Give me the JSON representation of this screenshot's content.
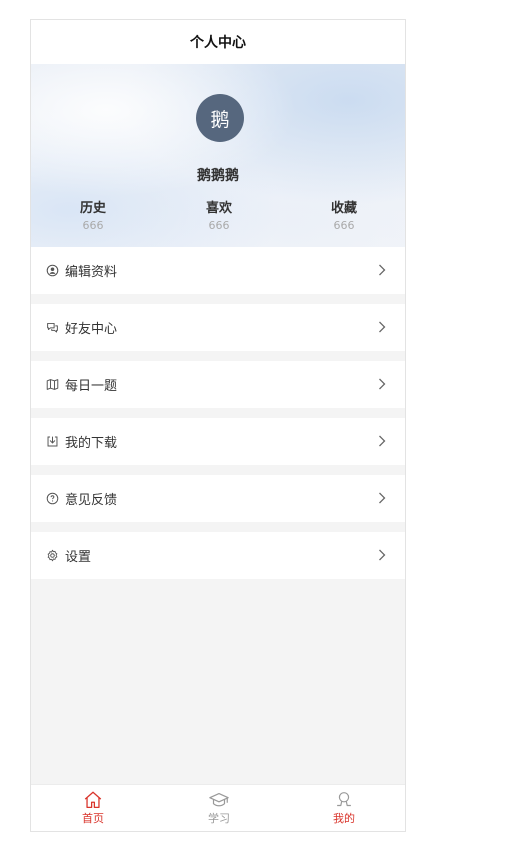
{
  "header": {
    "title": "个人中心"
  },
  "profile": {
    "avatar_text": "鹅",
    "username": "鹅鹅鹅",
    "stats": [
      {
        "label": "历史",
        "count": "666"
      },
      {
        "label": "喜欢",
        "count": "666"
      },
      {
        "label": "收藏",
        "count": "666"
      }
    ]
  },
  "menu": {
    "items": [
      {
        "label": "编辑资料",
        "icon": "user-circle-icon"
      },
      {
        "label": "好友中心",
        "icon": "chat-bubbles-icon"
      },
      {
        "label": "每日一题",
        "icon": "map-icon"
      },
      {
        "label": "我的下载",
        "icon": "download-icon"
      },
      {
        "label": "意见反馈",
        "icon": "question-circle-icon"
      },
      {
        "label": "设置",
        "icon": "gear-icon"
      }
    ]
  },
  "tabbar": {
    "items": [
      {
        "label": "首页",
        "icon": "home-icon",
        "active": true
      },
      {
        "label": "学习",
        "icon": "graduation-cap-icon",
        "active": false
      },
      {
        "label": "我的",
        "icon": "user-icon",
        "active": true
      }
    ]
  },
  "colors": {
    "accent": "#d9342b",
    "avatar_bg": "#56677e",
    "page_bg": "#f4f4f4"
  }
}
